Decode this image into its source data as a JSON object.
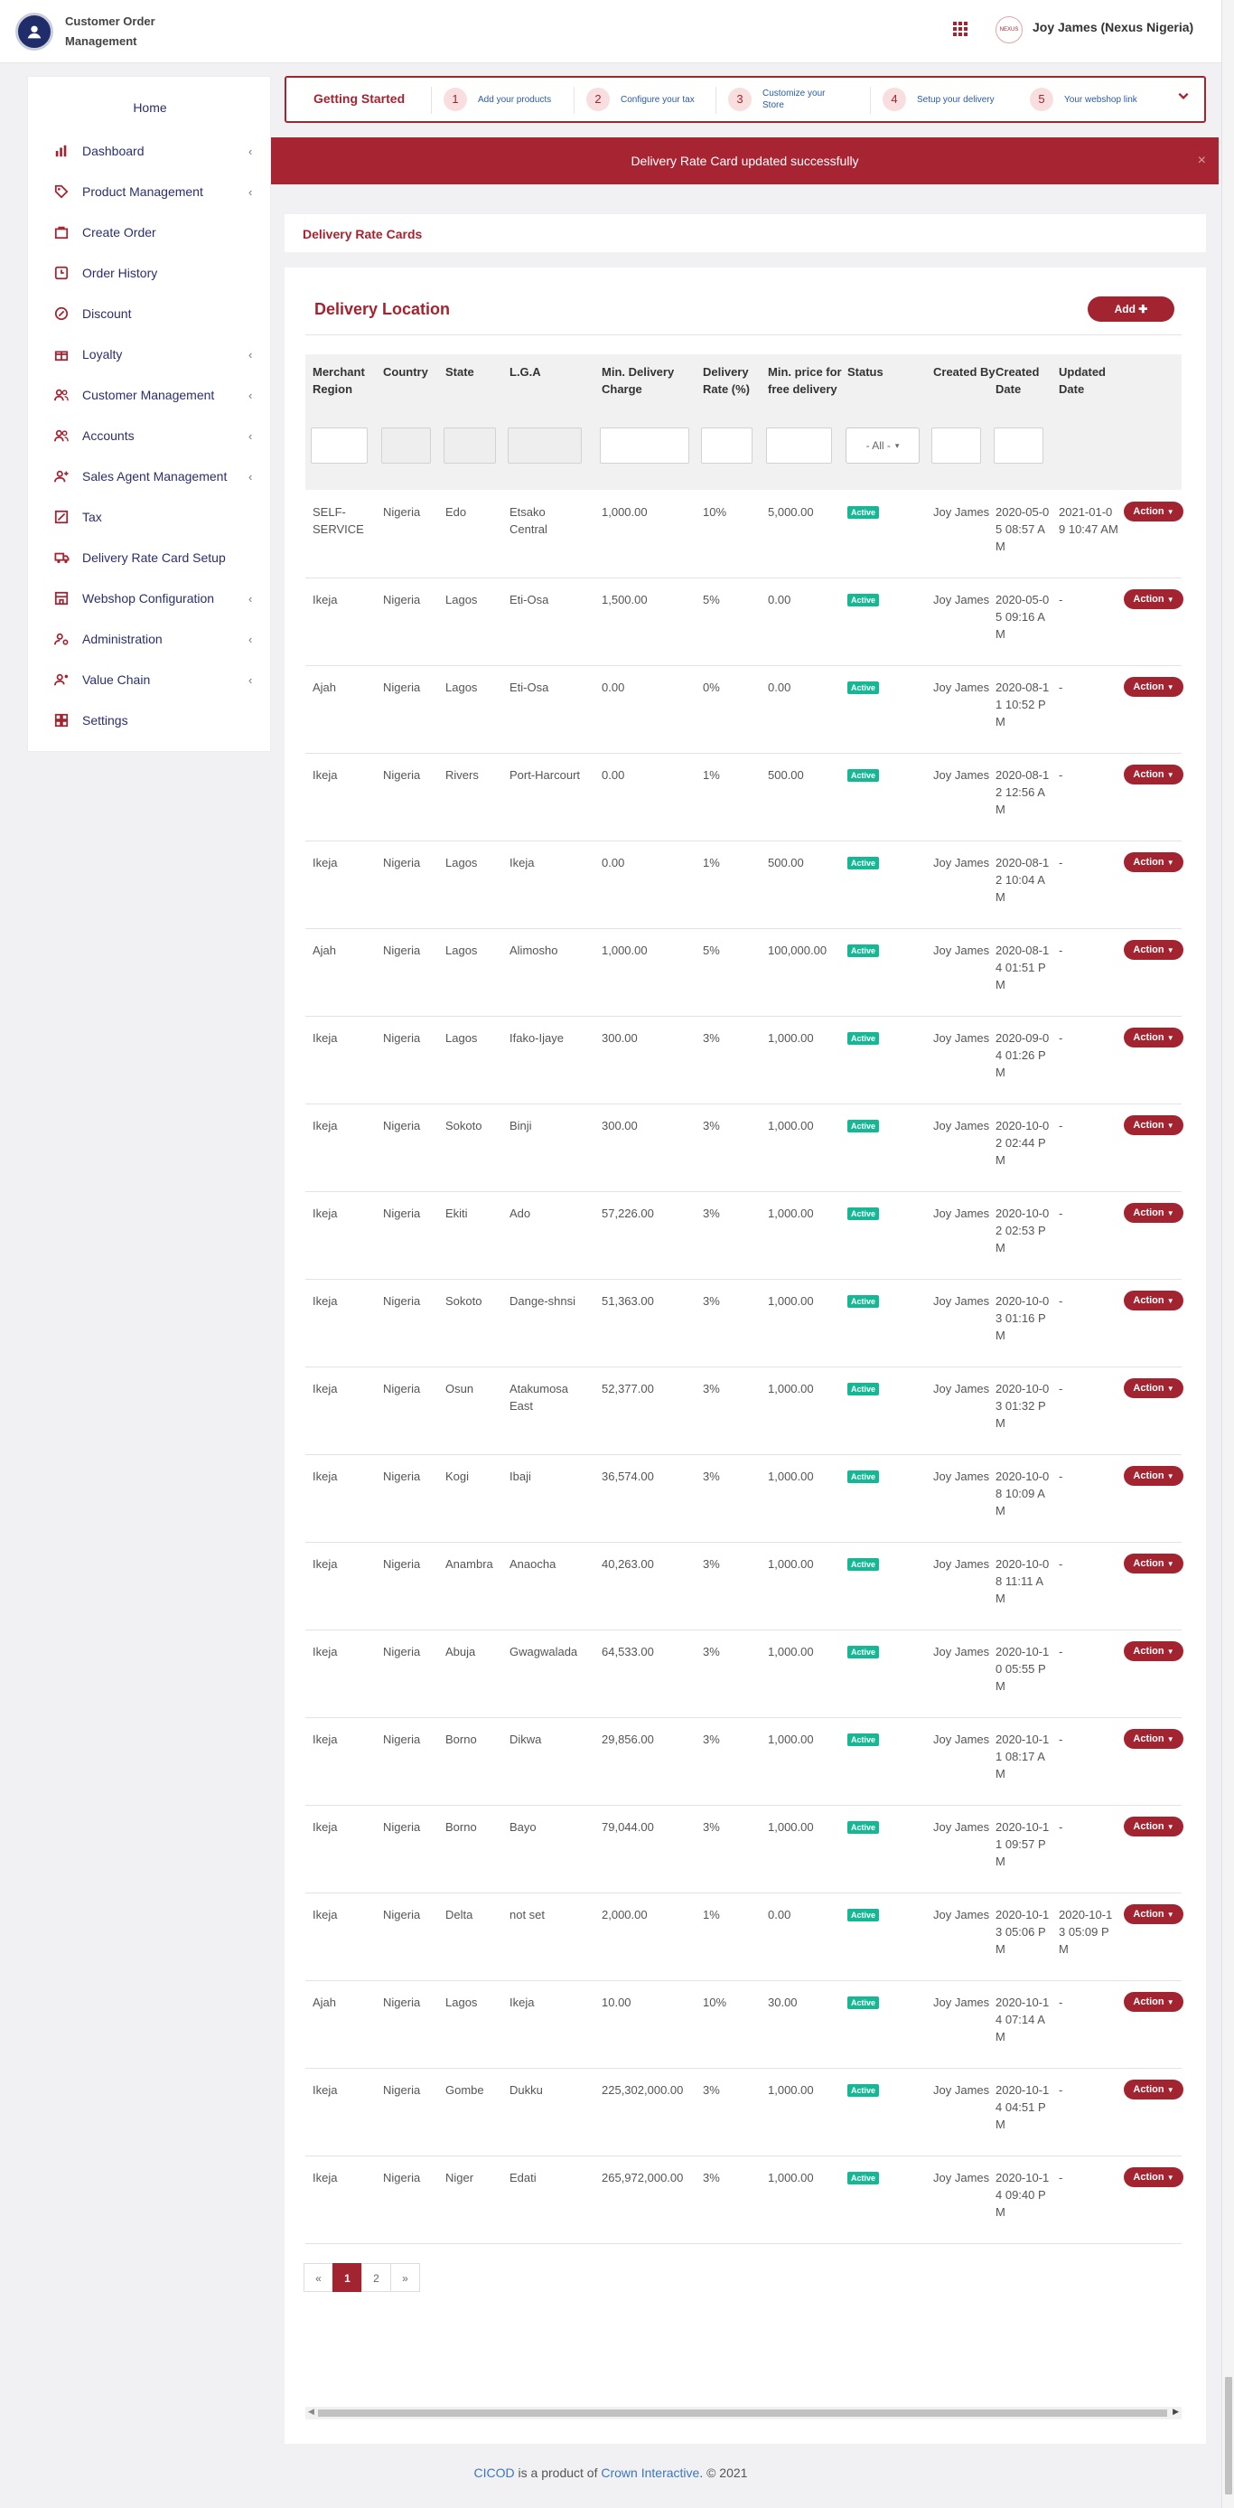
{
  "header": {
    "app_name": "Customer Order Management",
    "user_name": "Joy James (Nexus Nigeria)",
    "avatar_text": "NEXUS"
  },
  "sidebar": {
    "home": "Home",
    "items": [
      {
        "label": "Dashboard",
        "icon": "bar-chart-icon",
        "has_chevron": true
      },
      {
        "label": "Product Management",
        "icon": "tag-icon",
        "has_chevron": true
      },
      {
        "label": "Create Order",
        "icon": "shopping-bag-icon",
        "has_chevron": false
      },
      {
        "label": "Order History",
        "icon": "history-icon",
        "has_chevron": false
      },
      {
        "label": "Discount",
        "icon": "discount-icon",
        "has_chevron": false
      },
      {
        "label": "Loyalty",
        "icon": "gift-icon",
        "has_chevron": true
      },
      {
        "label": "Customer Management",
        "icon": "users-icon",
        "has_chevron": true
      },
      {
        "label": "Accounts",
        "icon": "users-icon",
        "has_chevron": true
      },
      {
        "label": "Sales Agent Management",
        "icon": "user-plus-icon",
        "has_chevron": true
      },
      {
        "label": "Tax",
        "icon": "percent-box-icon",
        "has_chevron": false
      },
      {
        "label": "Delivery Rate Card Setup",
        "icon": "truck-icon",
        "has_chevron": false
      },
      {
        "label": "Webshop Configuration",
        "icon": "store-icon",
        "has_chevron": true
      },
      {
        "label": "Administration",
        "icon": "user-cog-icon",
        "has_chevron": true
      },
      {
        "label": "Value Chain",
        "icon": "user-link-icon",
        "has_chevron": true
      },
      {
        "label": "Settings",
        "icon": "settings-icon",
        "has_chevron": false
      }
    ]
  },
  "getting_started": {
    "title": "Getting Started",
    "steps": [
      {
        "num": "1",
        "label": "Add your products"
      },
      {
        "num": "2",
        "label": "Configure your tax"
      },
      {
        "num": "3",
        "label": "Customize your Store"
      },
      {
        "num": "4",
        "label": "Setup your delivery"
      },
      {
        "num": "5",
        "label": "Your webshop link"
      }
    ]
  },
  "alert": {
    "message": "Delivery Rate Card updated successfully",
    "close": "×"
  },
  "section_title": "Delivery Rate Cards",
  "table": {
    "title": "Delivery Location",
    "add_label": "Add",
    "add_icon": "plus-icon",
    "columns": [
      "Merchant Region",
      "Country",
      "State",
      "L.G.A",
      "Min. Delivery Charge",
      "Delivery Rate (%)",
      "Min. price for free delivery",
      "Status",
      "Created By",
      "Created Date",
      "Updated Date"
    ],
    "status_filter": "- All -",
    "action_label": "Action",
    "rows": [
      {
        "region": "SELF-SERVICE",
        "country": "Nigeria",
        "state": "Edo",
        "lga": "Etsako Central",
        "min_charge": "1,000.00",
        "rate": "10%",
        "free": "5,000.00",
        "status": "Active",
        "by": "Joy James",
        "created": "2020-05-05 08:57 AM",
        "updated": "2021-01-09 10:47 AM"
      },
      {
        "region": "Ikeja",
        "country": "Nigeria",
        "state": "Lagos",
        "lga": "Eti-Osa",
        "min_charge": "1,500.00",
        "rate": "5%",
        "free": "0.00",
        "status": "Active",
        "by": "Joy James",
        "created": "2020-05-05 09:16 AM",
        "updated": "-"
      },
      {
        "region": "Ajah",
        "country": "Nigeria",
        "state": "Lagos",
        "lga": "Eti-Osa",
        "min_charge": "0.00",
        "rate": "0%",
        "free": "0.00",
        "status": "Active",
        "by": "Joy James",
        "created": "2020-08-11 10:52 PM",
        "updated": "-"
      },
      {
        "region": "Ikeja",
        "country": "Nigeria",
        "state": "Rivers",
        "lga": "Port-Harcourt",
        "min_charge": "0.00",
        "rate": "1%",
        "free": "500.00",
        "status": "Active",
        "by": "Joy James",
        "created": "2020-08-12 12:56 AM",
        "updated": "-"
      },
      {
        "region": "Ikeja",
        "country": "Nigeria",
        "state": "Lagos",
        "lga": "Ikeja",
        "min_charge": "0.00",
        "rate": "1%",
        "free": "500.00",
        "status": "Active",
        "by": "Joy James",
        "created": "2020-08-12 10:04 AM",
        "updated": "-"
      },
      {
        "region": "Ajah",
        "country": "Nigeria",
        "state": "Lagos",
        "lga": "Alimosho",
        "min_charge": "1,000.00",
        "rate": "5%",
        "free": "100,000.00",
        "status": "Active",
        "by": "Joy James",
        "created": "2020-08-14 01:51 PM",
        "updated": "-"
      },
      {
        "region": "Ikeja",
        "country": "Nigeria",
        "state": "Lagos",
        "lga": "Ifako-Ijaye",
        "min_charge": "300.00",
        "rate": "3%",
        "free": "1,000.00",
        "status": "Active",
        "by": "Joy James",
        "created": "2020-09-04 01:26 PM",
        "updated": "-"
      },
      {
        "region": "Ikeja",
        "country": "Nigeria",
        "state": "Sokoto",
        "lga": "Binji",
        "min_charge": "300.00",
        "rate": "3%",
        "free": "1,000.00",
        "status": "Active",
        "by": "Joy James",
        "created": "2020-10-02 02:44 PM",
        "updated": "-"
      },
      {
        "region": "Ikeja",
        "country": "Nigeria",
        "state": "Ekiti",
        "lga": "Ado",
        "min_charge": "57,226.00",
        "rate": "3%",
        "free": "1,000.00",
        "status": "Active",
        "by": "Joy James",
        "created": "2020-10-02 02:53 PM",
        "updated": "-"
      },
      {
        "region": "Ikeja",
        "country": "Nigeria",
        "state": "Sokoto",
        "lga": "Dange-shnsi",
        "min_charge": "51,363.00",
        "rate": "3%",
        "free": "1,000.00",
        "status": "Active",
        "by": "Joy James",
        "created": "2020-10-03 01:16 PM",
        "updated": "-"
      },
      {
        "region": "Ikeja",
        "country": "Nigeria",
        "state": "Osun",
        "lga": "Atakumosa East",
        "min_charge": "52,377.00",
        "rate": "3%",
        "free": "1,000.00",
        "status": "Active",
        "by": "Joy James",
        "created": "2020-10-03 01:32 PM",
        "updated": "-"
      },
      {
        "region": "Ikeja",
        "country": "Nigeria",
        "state": "Kogi",
        "lga": "Ibaji",
        "min_charge": "36,574.00",
        "rate": "3%",
        "free": "1,000.00",
        "status": "Active",
        "by": "Joy James",
        "created": "2020-10-08 10:09 AM",
        "updated": "-"
      },
      {
        "region": "Ikeja",
        "country": "Nigeria",
        "state": "Anambra",
        "lga": "Anaocha",
        "min_charge": "40,263.00",
        "rate": "3%",
        "free": "1,000.00",
        "status": "Active",
        "by": "Joy James",
        "created": "2020-10-08 11:11 AM",
        "updated": "-"
      },
      {
        "region": "Ikeja",
        "country": "Nigeria",
        "state": "Abuja",
        "lga": "Gwagwalada",
        "min_charge": "64,533.00",
        "rate": "3%",
        "free": "1,000.00",
        "status": "Active",
        "by": "Joy James",
        "created": "2020-10-10 05:55 PM",
        "updated": "-"
      },
      {
        "region": "Ikeja",
        "country": "Nigeria",
        "state": "Borno",
        "lga": "Dikwa",
        "min_charge": "29,856.00",
        "rate": "3%",
        "free": "1,000.00",
        "status": "Active",
        "by": "Joy James",
        "created": "2020-10-11 08:17 AM",
        "updated": "-"
      },
      {
        "region": "Ikeja",
        "country": "Nigeria",
        "state": "Borno",
        "lga": "Bayo",
        "min_charge": "79,044.00",
        "rate": "3%",
        "free": "1,000.00",
        "status": "Active",
        "by": "Joy James",
        "created": "2020-10-11 09:57 PM",
        "updated": "-"
      },
      {
        "region": "Ikeja",
        "country": "Nigeria",
        "state": "Delta",
        "lga": "not set",
        "min_charge": "2,000.00",
        "rate": "1%",
        "free": "0.00",
        "status": "Active",
        "by": "Joy James",
        "created": "2020-10-13 05:06 PM",
        "updated": "2020-10-13 05:09 PM"
      },
      {
        "region": "Ajah",
        "country": "Nigeria",
        "state": "Lagos",
        "lga": "Ikeja",
        "min_charge": "10.00",
        "rate": "10%",
        "free": "30.00",
        "status": "Active",
        "by": "Joy James",
        "created": "2020-10-14 07:14 AM",
        "updated": "-"
      },
      {
        "region": "Ikeja",
        "country": "Nigeria",
        "state": "Gombe",
        "lga": "Dukku",
        "min_charge": "225,302,000.00",
        "rate": "3%",
        "free": "1,000.00",
        "status": "Active",
        "by": "Joy James",
        "created": "2020-10-14 04:51 PM",
        "updated": "-"
      },
      {
        "region": "Ikeja",
        "country": "Nigeria",
        "state": "Niger",
        "lga": "Edati",
        "min_charge": "265,972,000.00",
        "rate": "3%",
        "free": "1,000.00",
        "status": "Active",
        "by": "Joy James",
        "created": "2020-10-14 09:40 PM",
        "updated": "-"
      }
    ]
  },
  "pagination": {
    "prev": "«",
    "pages": [
      "1",
      "2"
    ],
    "current": "1",
    "next": "»"
  },
  "footer": {
    "brand": "CICOD",
    "middle": " is a product of ",
    "company": "Crown Interactive",
    "suffix": ". © 2021"
  },
  "colors": {
    "primary": "#a32431",
    "active_badge": "#15b794",
    "link": "#2a5aa6"
  }
}
